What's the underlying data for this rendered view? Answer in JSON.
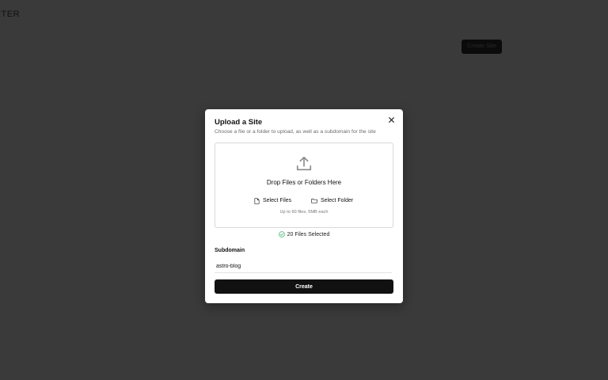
{
  "background": {
    "logo_text": "ITER",
    "create_button_label": "Create Site"
  },
  "modal": {
    "title": "Upload a Site",
    "subtitle": "Choose a file or a folder to upload, as well as a subdomain for the site",
    "close_icon": "close-icon",
    "dropzone": {
      "icon": "upload-icon",
      "drop_text": "Drop Files or Folders Here",
      "select_files_label": "Select Files",
      "select_folder_label": "Select Folder",
      "limit_text": "Up to 60 files, 5MB each"
    },
    "selection_status": "20 Files Selected",
    "subdomain": {
      "label": "Subdomain",
      "value": "astro-blog"
    },
    "create_label": "Create"
  },
  "colors": {
    "overlay": "#3a3a3a",
    "primary_button": "#111111",
    "success": "#3db36b"
  }
}
